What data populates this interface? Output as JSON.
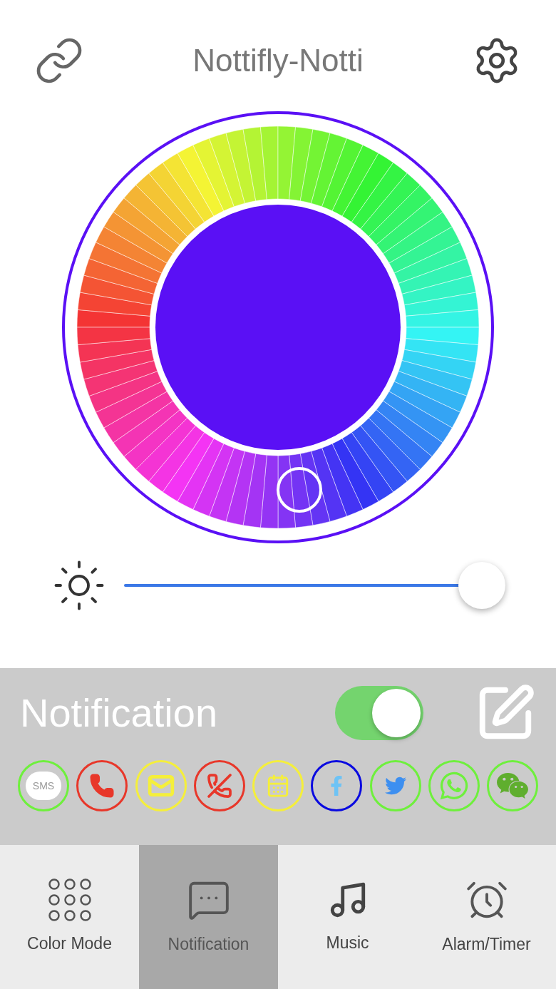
{
  "header": {
    "title": "Nottifly-Notti"
  },
  "brightness": {
    "level": 0.94
  },
  "notification": {
    "label": "Notification",
    "on": true
  },
  "apps": [
    {
      "kind": "sms",
      "label": "SMS",
      "color": "#6ef03c"
    },
    {
      "kind": "call",
      "color": "#e8372a"
    },
    {
      "kind": "mail",
      "color": "#f5ef3a"
    },
    {
      "kind": "missed-call",
      "color": "#e8372a"
    },
    {
      "kind": "calendar",
      "color": "#f5ef3a"
    },
    {
      "kind": "facebook",
      "color": "#0a0ae0"
    },
    {
      "kind": "twitter",
      "color": "#6ef03c"
    },
    {
      "kind": "whatsapp",
      "color": "#6ef03c"
    },
    {
      "kind": "wechat",
      "color": "#6ef03c"
    }
  ],
  "tabs": [
    {
      "kind": "color-mode",
      "label": "Color Mode",
      "selected": false
    },
    {
      "kind": "notification",
      "label": "Notification",
      "selected": true
    },
    {
      "kind": "music",
      "label": "Music",
      "selected": false
    },
    {
      "kind": "alarm",
      "label": "Alarm/Timer",
      "selected": false
    }
  ]
}
